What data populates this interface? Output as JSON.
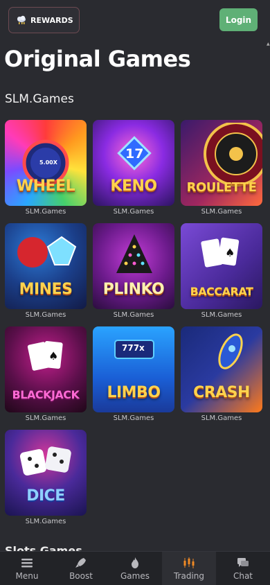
{
  "header": {
    "rewards_label": "REWARDS",
    "login_label": "Login"
  },
  "page_title": "Original Games",
  "section_title": "SLM.Games",
  "games": [
    {
      "name": "WHEEL",
      "provider": "SLM.Games",
      "badge": "5.00X"
    },
    {
      "name": "KENO",
      "provider": "SLM.Games",
      "badge": "17"
    },
    {
      "name": "ROULETTE",
      "provider": "SLM.Games"
    },
    {
      "name": "MINES",
      "provider": "SLM.Games"
    },
    {
      "name": "PLINKO",
      "provider": "SLM.Games"
    },
    {
      "name": "BACCARAT",
      "provider": "SLM.Games"
    },
    {
      "name": "BLACKJACK",
      "provider": "SLM.Games"
    },
    {
      "name": "LIMBO",
      "provider": "SLM.Games",
      "badge": "777x"
    },
    {
      "name": "CRASH",
      "provider": "SLM.Games"
    },
    {
      "name": "DICE",
      "provider": "SLM.Games"
    }
  ],
  "next_section_title": "Slots Games",
  "bottom_nav": [
    {
      "label": "Menu",
      "icon": "menu-icon"
    },
    {
      "label": "Boost",
      "icon": "rocket-icon"
    },
    {
      "label": "Games",
      "icon": "flame-icon"
    },
    {
      "label": "Trading",
      "icon": "candlestick-icon"
    },
    {
      "label": "Chat",
      "icon": "chat-icon"
    }
  ],
  "colors": {
    "background": "#2a2b30",
    "login_green": "#5fb076",
    "nav_background": "#222327",
    "trading_accent": "#f08a24"
  }
}
